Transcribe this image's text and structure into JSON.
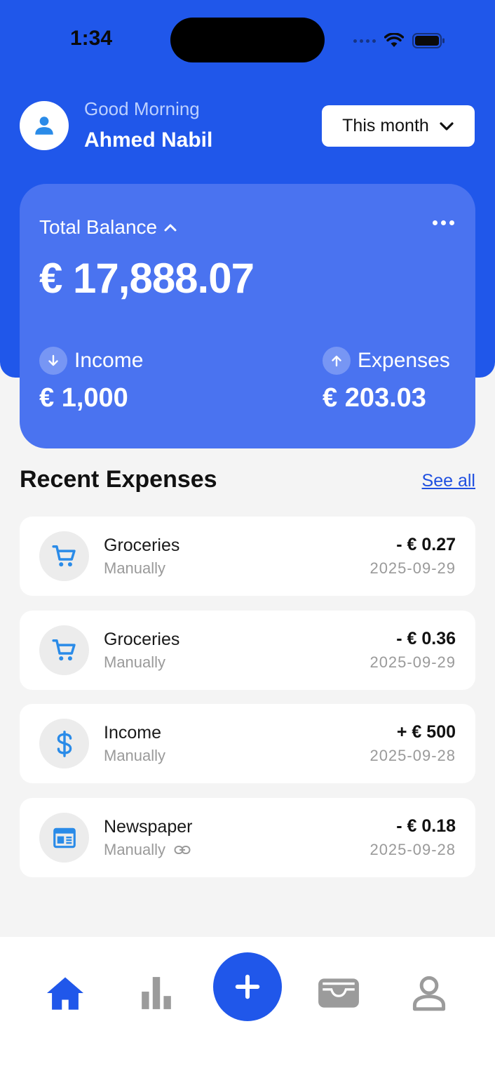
{
  "status_bar": {
    "time": "1:34"
  },
  "header": {
    "greeting": "Good Morning",
    "user_name": "Ahmed Nabil",
    "period_selector": "This month"
  },
  "balance": {
    "label": "Total Balance",
    "amount": "€ 17,888.07",
    "income_label": "Income",
    "income_amount": "€ 1,000",
    "expenses_label": "Expenses",
    "expenses_amount": "€ 203.03"
  },
  "recent": {
    "title": "Recent Expenses",
    "see_all": "See all",
    "items": [
      {
        "name": "Groceries",
        "source": "Manually",
        "amount": "- € 0.27",
        "date": "2025-09-29",
        "icon": "cart-icon"
      },
      {
        "name": "Groceries",
        "source": "Manually",
        "amount": "- € 0.36",
        "date": "2025-09-29",
        "icon": "cart-icon"
      },
      {
        "name": "Income",
        "source": "Manually",
        "amount": "+ € 500",
        "date": "2025-09-28",
        "icon": "dollar-icon"
      },
      {
        "name": "Newspaper",
        "source": "Manually",
        "amount": "- € 0.18",
        "date": "2025-09-28",
        "icon": "newspaper-icon",
        "linked": true
      }
    ]
  },
  "bottom_nav": [
    "home-icon",
    "stats-icon",
    "add-icon",
    "wallet-icon",
    "profile-icon"
  ],
  "colors": {
    "primary": "#2057ea",
    "card": "#4a73f0",
    "icon_blue": "#2a8be8",
    "inactive": "#9b9b9b"
  }
}
